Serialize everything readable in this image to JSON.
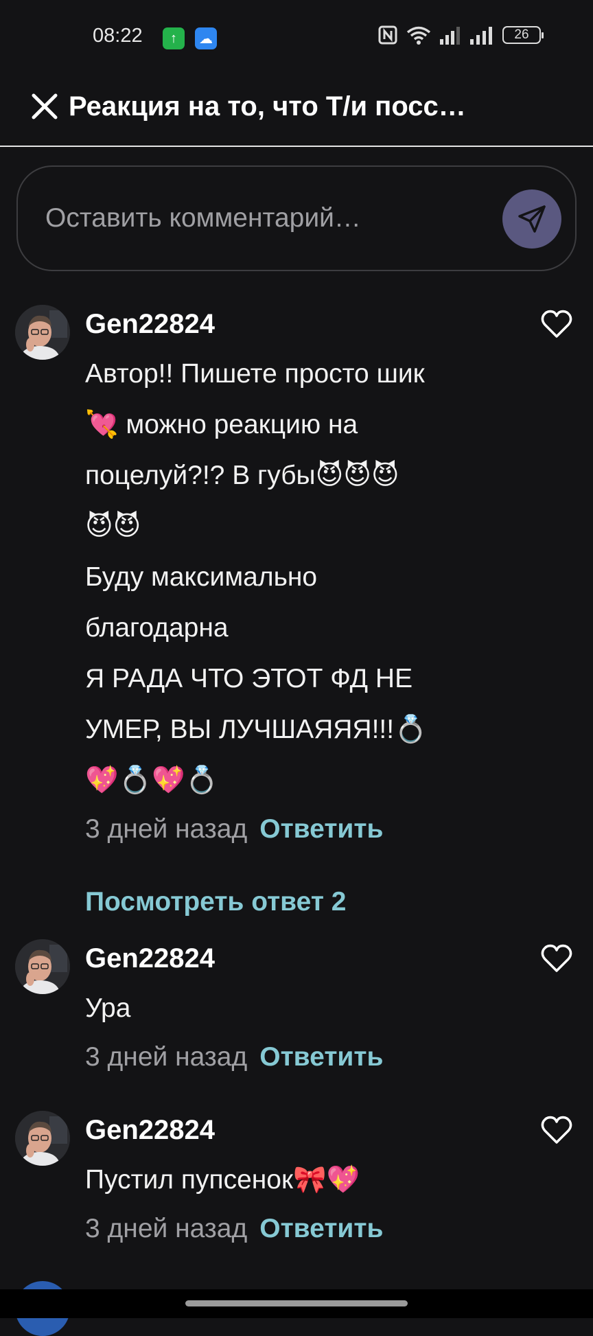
{
  "status_bar": {
    "time": "08:22",
    "battery": "26",
    "icons": [
      "app-green-icon",
      "weather-icon",
      "nfc-icon",
      "wifi-icon",
      "signal-icon",
      "battery-icon"
    ]
  },
  "header": {
    "title": "Реакция на то, что Т/и посс…"
  },
  "comment_box": {
    "placeholder": "Оставить комментарий…"
  },
  "comments": [
    {
      "author": "Gen22824",
      "lines": [
        "Автор!! Пишете просто шик",
        "💘 можно реакцию на",
        "поцелуй?!? В губы😈😈😈",
        "😈😈",
        "Буду максимально",
        "благодарна",
        "Я РАДА ЧТО ЭТОТ ФД НЕ",
        "УМЕР, ВЫ ЛУЧШАЯЯЯ!!!💍",
        "💖💍💖💍"
      ],
      "time": "3 дней назад",
      "reply": "Ответить"
    },
    {
      "author": "Gen22824",
      "lines": [
        "Ура"
      ],
      "time": "3 дней назад",
      "reply": "Ответить"
    },
    {
      "author": "Gen22824",
      "lines": [
        "Пустил пупсенок🎀💖"
      ],
      "time": "3 дней назад",
      "reply": "Ответить"
    }
  ],
  "view_replies": "Посмотреть ответ 2",
  "colors": {
    "background": "#131315",
    "accent": "#86c9d4",
    "send_button": "#5a5880",
    "muted_text": "#a0a0a4"
  }
}
